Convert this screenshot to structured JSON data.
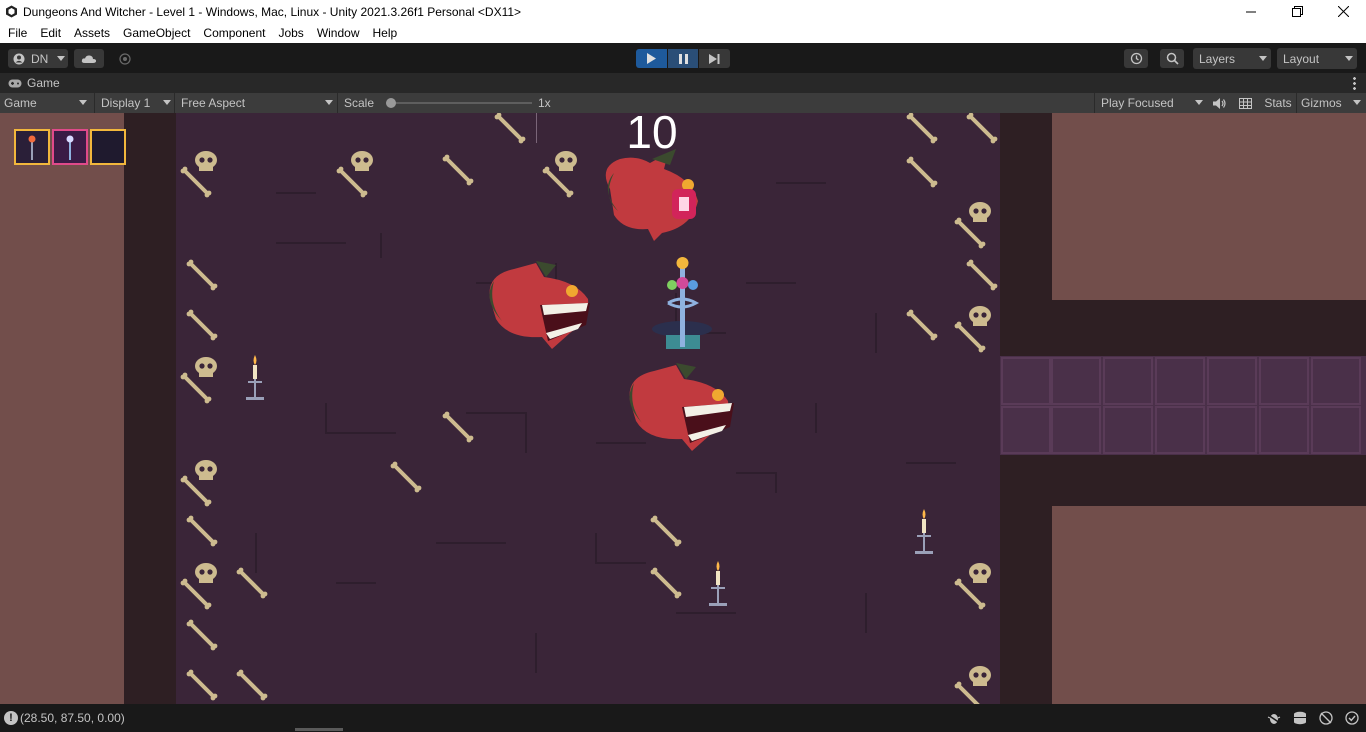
{
  "window": {
    "title": "Dungeons And Witcher - Level 1 - Windows, Mac, Linux - Unity 2021.3.26f1 Personal <DX11>"
  },
  "menu": [
    "File",
    "Edit",
    "Assets",
    "GameObject",
    "Component",
    "Jobs",
    "Window",
    "Help"
  ],
  "toolbar": {
    "account": "DN",
    "layers": "Layers",
    "layout": "Layout"
  },
  "game_tab": {
    "label": "Game",
    "view_mode": "Game",
    "display": "Display 1",
    "aspect": "Free Aspect",
    "scale_label": "Scale",
    "scale_value": "1x",
    "scale_fraction": 0.0,
    "play_mode": "Play Focused",
    "stats": "Stats",
    "gizmos": "Gizmos"
  },
  "game": {
    "score": "10",
    "inventory_slots": [
      {
        "item": "fire-staff",
        "color": "#f2b73c"
      },
      {
        "item": "magic-staff",
        "color": "#e04a8a"
      },
      {
        "item": "empty",
        "color": "#f2b73c"
      }
    ]
  },
  "status": {
    "coords": "(28.50, 87.50, 0.00)"
  },
  "colors": {
    "floor": "#3a2538",
    "wall": "#2e1f23",
    "outside": "#724e4b",
    "play_accent": "#1e5a9c"
  }
}
